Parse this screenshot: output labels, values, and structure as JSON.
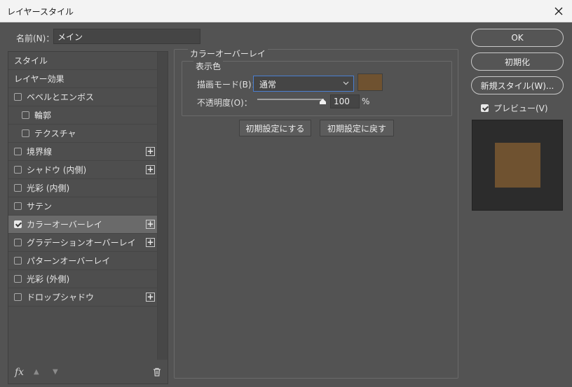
{
  "window": {
    "title": "レイヤースタイル"
  },
  "name": {
    "label": "名前(N)：",
    "value": "メイン"
  },
  "styles_list": [
    {
      "label": "スタイル",
      "checkbox": false,
      "checked": false,
      "plus": false,
      "sub": false,
      "selected": false
    },
    {
      "label": "レイヤー効果",
      "checkbox": false,
      "checked": false,
      "plus": false,
      "sub": false,
      "selected": false
    },
    {
      "label": "ベベルとエンボス",
      "checkbox": true,
      "checked": false,
      "plus": false,
      "sub": false,
      "selected": false
    },
    {
      "label": "輪郭",
      "checkbox": true,
      "checked": false,
      "plus": false,
      "sub": true,
      "selected": false
    },
    {
      "label": "テクスチャ",
      "checkbox": true,
      "checked": false,
      "plus": false,
      "sub": true,
      "selected": false
    },
    {
      "label": "境界線",
      "checkbox": true,
      "checked": false,
      "plus": true,
      "sub": false,
      "selected": false
    },
    {
      "label": "シャドウ (内側)",
      "checkbox": true,
      "checked": false,
      "plus": true,
      "sub": false,
      "selected": false
    },
    {
      "label": "光彩 (内側)",
      "checkbox": true,
      "checked": false,
      "plus": false,
      "sub": false,
      "selected": false
    },
    {
      "label": "サテン",
      "checkbox": true,
      "checked": false,
      "plus": false,
      "sub": false,
      "selected": false
    },
    {
      "label": "カラーオーバーレイ",
      "checkbox": true,
      "checked": true,
      "plus": true,
      "sub": false,
      "selected": true
    },
    {
      "label": "グラデーションオーバーレイ",
      "checkbox": true,
      "checked": false,
      "plus": true,
      "sub": false,
      "selected": false
    },
    {
      "label": "パターンオーバーレイ",
      "checkbox": true,
      "checked": false,
      "plus": false,
      "sub": false,
      "selected": false
    },
    {
      "label": "光彩 (外側)",
      "checkbox": true,
      "checked": false,
      "plus": false,
      "sub": false,
      "selected": false
    },
    {
      "label": "ドロップシャドウ",
      "checkbox": true,
      "checked": false,
      "plus": true,
      "sub": false,
      "selected": false
    }
  ],
  "footer_icons": {
    "fx": "fx",
    "up": "▲",
    "down": "▼",
    "trash": "trash-icon"
  },
  "overlay": {
    "group_title": "カラーオーバーレイ",
    "subgroup_title": "表示色",
    "blend_label": "描画モード(B)：",
    "blend_value": "通常",
    "color": "#6f5230",
    "opacity_label": "不透明度(O)：",
    "opacity_value": "100",
    "opacity_fraction": 1.0,
    "opacity_unit": "%",
    "make_default": "初期設定にする",
    "reset_default": "初期設定に戻す"
  },
  "right": {
    "ok": "OK",
    "reset": "初期化",
    "new_style": "新規スタイル(W)...",
    "preview_label": "プレビュー(V)",
    "preview_checked": true
  }
}
